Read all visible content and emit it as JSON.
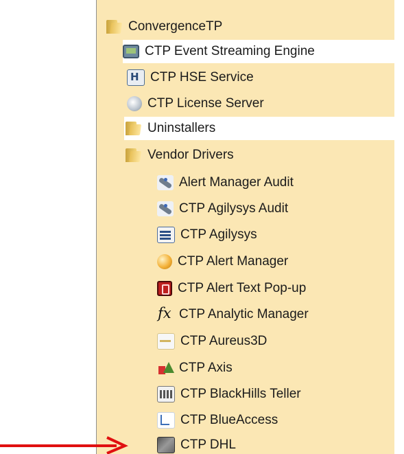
{
  "menu": {
    "rows": [
      {
        "label": "ConvergenceTP",
        "icon": "folder-icon",
        "highlight": false
      },
      {
        "label": "CTP Event Streaming Engine",
        "icon": "monitor-app-icon",
        "highlight": true
      },
      {
        "label": "CTP HSE Service",
        "icon": "hse-service-icon",
        "highlight": false
      },
      {
        "label": "CTP License Server",
        "icon": "license-server-icon",
        "highlight": false
      },
      {
        "label": "Uninstallers",
        "icon": "folder-icon",
        "highlight": true
      },
      {
        "label": "Vendor Drivers",
        "icon": "folder-icon",
        "highlight": false
      },
      {
        "label": "Alert Manager Audit",
        "icon": "satellite-icon",
        "highlight": false
      },
      {
        "label": "CTP Agilysys Audit",
        "icon": "satellite-icon",
        "highlight": false
      },
      {
        "label": "CTP Agilysys",
        "icon": "agilysys-icon",
        "highlight": false
      },
      {
        "label": "CTP Alert Manager",
        "icon": "alert-manager-icon",
        "highlight": false
      },
      {
        "label": "CTP Alert Text Pop-up",
        "icon": "alert-text-icon",
        "highlight": false
      },
      {
        "label": "CTP Analytic Manager",
        "icon": "fx-function-icon",
        "highlight": false
      },
      {
        "label": "CTP Aureus3D",
        "icon": "aureus3d-icon",
        "highlight": false
      },
      {
        "label": "CTP Axis",
        "icon": "axis-icon",
        "highlight": false
      },
      {
        "label": "CTP BlackHills Teller",
        "icon": "bank-icon",
        "highlight": false
      },
      {
        "label": "CTP BlueAccess",
        "icon": "blueaccess-icon",
        "highlight": false
      },
      {
        "label": "CTP DHL",
        "icon": "dhl-icon",
        "highlight": false
      }
    ]
  },
  "annotation": {
    "arrow_color": "#e01010"
  },
  "colors": {
    "panel_bg": "#fbe7b4",
    "highlight_bg": "#ffffff"
  }
}
